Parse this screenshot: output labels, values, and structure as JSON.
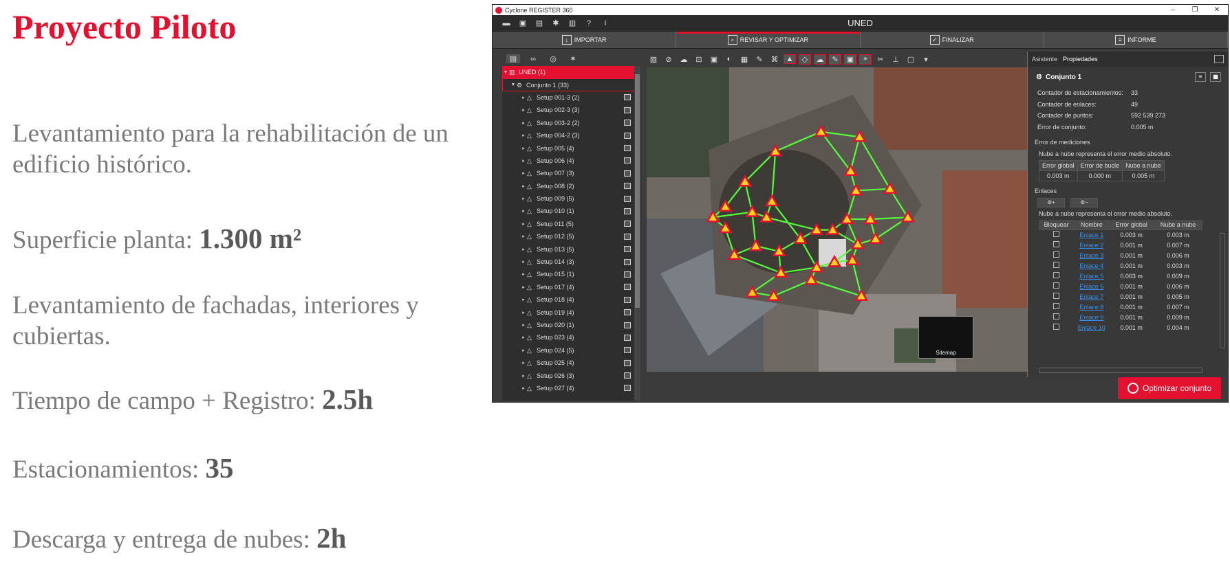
{
  "slide": {
    "title": "Proyecto Piloto",
    "line1": "Levantamiento para la rehabilitación de un edificio histórico.",
    "surface_label": "Superficie planta: ",
    "surface_value": "1.300 m²",
    "facades": "Levantamiento de fachadas, interiores y cubiertas.",
    "time_label": "Tiempo de campo + Registro: ",
    "time_value": "2.5h",
    "stations_label": "Estacionamientos: ",
    "stations_value": "35",
    "download_label": "Descarga y entrega de nubes: ",
    "download_value": "2h"
  },
  "app": {
    "window_title": "Cyclone REGISTER 360",
    "window_controls": [
      "–",
      "❐",
      "✕"
    ],
    "project_name": "UNED",
    "workflow": [
      {
        "label": "IMPORTAR",
        "icon": "import-icon"
      },
      {
        "label": "REVISAR Y OPTIMIZAR",
        "icon": "review-icon"
      },
      {
        "label": "FINALIZAR",
        "icon": "finalize-icon"
      },
      {
        "label": "INFORME",
        "icon": "report-icon"
      }
    ],
    "tree": {
      "root": "UNED (1)",
      "bundle": "Conjunto 1 (33)",
      "setups": [
        "Setup 001-3 (2)",
        "Setup 002-3 (3)",
        "Setup 003-2 (2)",
        "Setup 004-2 (3)",
        "Setup 005 (4)",
        "Setup 006 (4)",
        "Setup 007 (3)",
        "Setup 008 (2)",
        "Setup 009 (5)",
        "Setup 010 (1)",
        "Setup 011 (5)",
        "Setup 012 (5)",
        "Setup 013 (5)",
        "Setup 014 (3)",
        "Setup 015 (1)",
        "Setup 017 (4)",
        "Setup 018 (4)",
        "Setup 019 (4)",
        "Setup 020 (1)",
        "Setup 023 (4)",
        "Setup 024 (5)",
        "Setup 025 (4)",
        "Setup 026 (3)",
        "Setup 027 (4)"
      ]
    },
    "sitemap_label": "Sitemap",
    "panel": {
      "tabs": [
        "Asistente",
        "Propiedades"
      ],
      "header": "Conjunto 1",
      "stats": [
        {
          "k": "Contador de estacionamientos:",
          "v": "33"
        },
        {
          "k": "Contador de enlaces:",
          "v": "49"
        },
        {
          "k": "Contador de puntos:",
          "v": "592 539 273"
        },
        {
          "k": "Error de conjunto:",
          "v": "0.005 m"
        }
      ],
      "measure_title": "Error de mediciones",
      "measure_note": "Nube a nube representa el error medio absoluto.",
      "measure_headers": [
        "Error global",
        "Error de bucle",
        "Nube a nube"
      ],
      "measure_values": [
        "0.003 m",
        "0.000 m",
        "0.005 m"
      ],
      "links_title": "Enlaces",
      "links_note": "Nube a nube representa el error medio absoluto.",
      "links_headers": [
        "Bloquear",
        "Nombre",
        "Error global",
        "Nube a nube"
      ],
      "links": [
        {
          "name": "Enlace 1",
          "global": "0.003 m",
          "cloud": "0.003 m"
        },
        {
          "name": "Enlace 2",
          "global": "0.001 m",
          "cloud": "0.007 m"
        },
        {
          "name": "Enlace 3",
          "global": "0.001 m",
          "cloud": "0.006 m"
        },
        {
          "name": "Enlace 4",
          "global": "0.001 m",
          "cloud": "0.003 m"
        },
        {
          "name": "Enlace 5",
          "global": "0.003 m",
          "cloud": "0.009 m"
        },
        {
          "name": "Enlace 6",
          "global": "0.001 m",
          "cloud": "0.006 m"
        },
        {
          "name": "Enlace 7",
          "global": "0.001 m",
          "cloud": "0.005 m"
        },
        {
          "name": "Enlace 8",
          "global": "0.001 m",
          "cloud": "0.007 m"
        },
        {
          "name": "Enlace 9",
          "global": "0.001 m",
          "cloud": "0.009 m"
        },
        {
          "name": "Enlace 10",
          "global": "0.001 m",
          "cloud": "0.004 m"
        }
      ],
      "optimize_label": "Optimizar conjunto"
    }
  }
}
